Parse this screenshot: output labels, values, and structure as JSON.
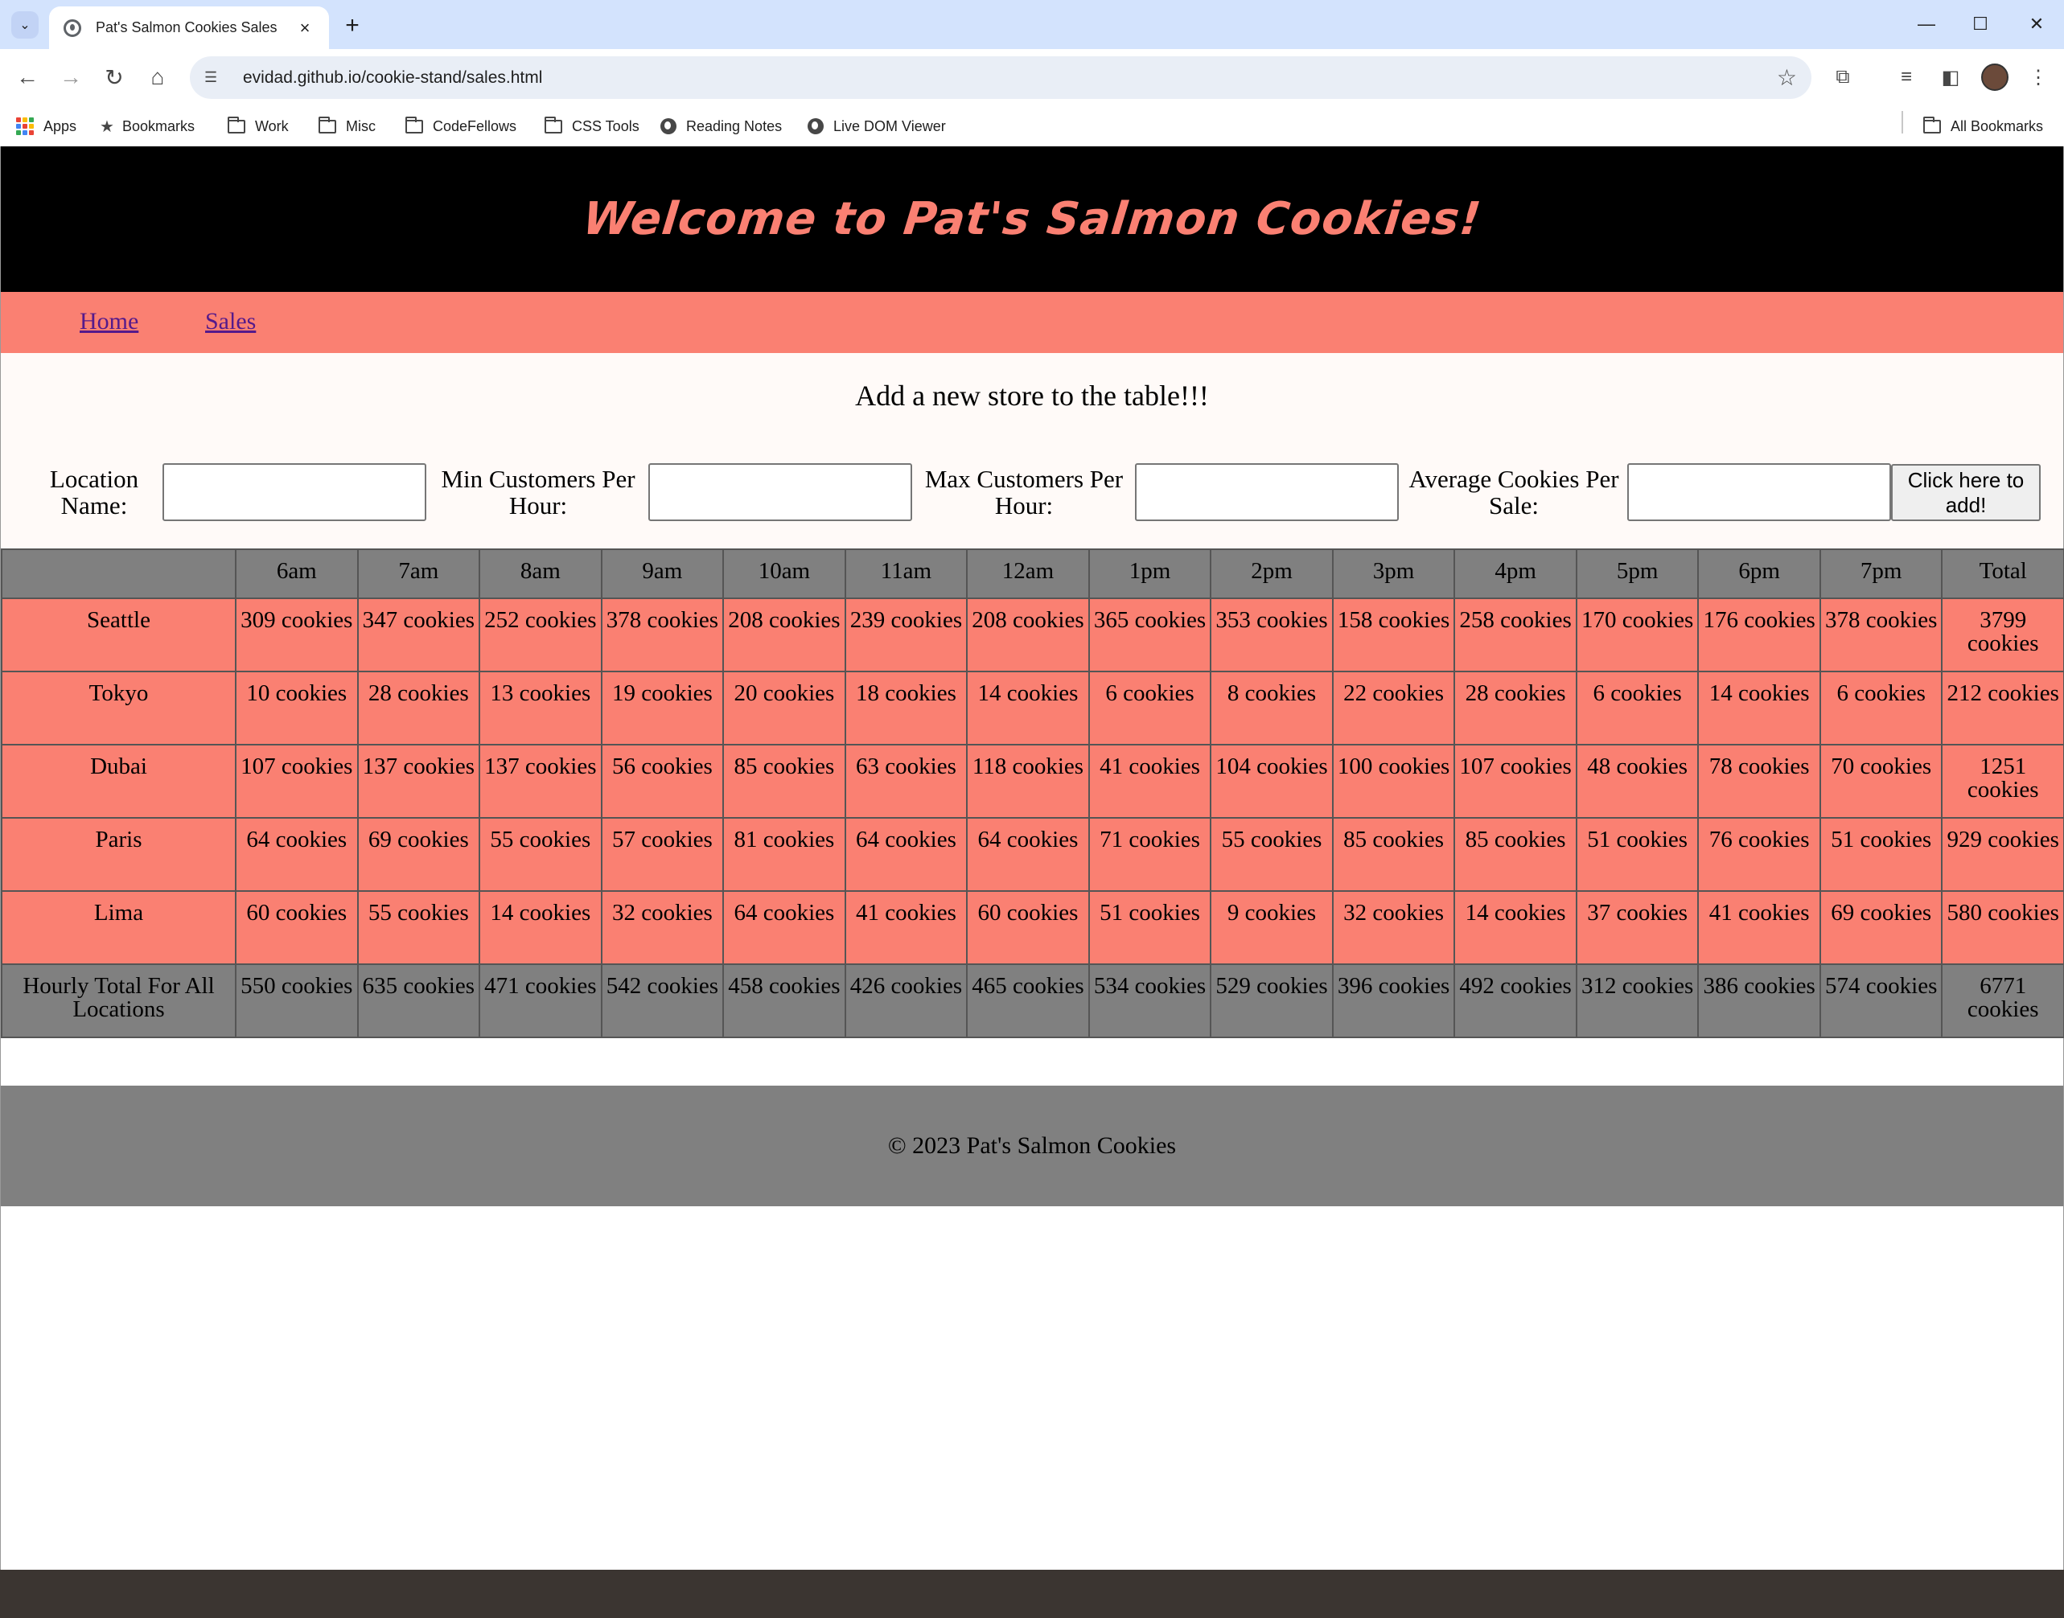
{
  "browser": {
    "tab_title": "Pat's Salmon Cookies Sales",
    "url": "evidad.github.io/cookie-stand/sales.html",
    "bookmarks": [
      "Apps",
      "Bookmarks",
      "Work",
      "Misc",
      "CodeFellows",
      "CSS Tools",
      "Reading Notes",
      "Live DOM Viewer"
    ],
    "all_bookmarks": "All Bookmarks"
  },
  "header": {
    "title": "Welcome to Pat's Salmon Cookies!"
  },
  "nav": {
    "home": "Home",
    "sales": "Sales"
  },
  "form": {
    "heading": "Add a new store to the table!!!",
    "location_label": "Location Name:",
    "min_label": "Min Customers Per Hour:",
    "max_label": "Max Customers Per Hour:",
    "avg_label": "Average Cookies Per Sale:",
    "location_value": "",
    "min_value": "",
    "max_value": "",
    "avg_value": "",
    "submit_label": "Click here to add!"
  },
  "table": {
    "header": [
      "",
      "6am",
      "7am",
      "8am",
      "9am",
      "10am",
      "11am",
      "12am",
      "1pm",
      "2pm",
      "3pm",
      "4pm",
      "5pm",
      "6pm",
      "7pm",
      "Total"
    ],
    "rows": [
      [
        "Seattle",
        "309 cookies",
        "347 cookies",
        "252 cookies",
        "378 cookies",
        "208 cookies",
        "239 cookies",
        "208 cookies",
        "365 cookies",
        "353 cookies",
        "158 cookies",
        "258 cookies",
        "170 cookies",
        "176 cookies",
        "378 cookies",
        "3799 cookies"
      ],
      [
        "Tokyo",
        "10 cookies",
        "28 cookies",
        "13 cookies",
        "19 cookies",
        "20 cookies",
        "18 cookies",
        "14 cookies",
        "6 cookies",
        "8 cookies",
        "22 cookies",
        "28 cookies",
        "6 cookies",
        "14 cookies",
        "6 cookies",
        "212 cookies"
      ],
      [
        "Dubai",
        "107 cookies",
        "137 cookies",
        "137 cookies",
        "56 cookies",
        "85 cookies",
        "63 cookies",
        "118 cookies",
        "41 cookies",
        "104 cookies",
        "100 cookies",
        "107 cookies",
        "48 cookies",
        "78 cookies",
        "70 cookies",
        "1251 cookies"
      ],
      [
        "Paris",
        "64 cookies",
        "69 cookies",
        "55 cookies",
        "57 cookies",
        "81 cookies",
        "64 cookies",
        "64 cookies",
        "71 cookies",
        "55 cookies",
        "85 cookies",
        "85 cookies",
        "51 cookies",
        "76 cookies",
        "51 cookies",
        "929 cookies"
      ],
      [
        "Lima",
        "60 cookies",
        "55 cookies",
        "14 cookies",
        "32 cookies",
        "64 cookies",
        "41 cookies",
        "60 cookies",
        "51 cookies",
        "9 cookies",
        "32 cookies",
        "14 cookies",
        "37 cookies",
        "41 cookies",
        "69 cookies",
        "580 cookies"
      ]
    ],
    "footer": [
      "Hourly Total For All Locations",
      "550 cookies",
      "635 cookies",
      "471 cookies",
      "542 cookies",
      "458 cookies",
      "426 cookies",
      "465 cookies",
      "534 cookies",
      "529 cookies",
      "396 cookies",
      "492 cookies",
      "312 cookies",
      "386 cookies",
      "574 cookies",
      "6771 cookies"
    ]
  },
  "footer": {
    "text": "© 2023 Pat's Salmon Cookies"
  },
  "colors": {
    "salmon": "#fa8072",
    "header_bg": "#000000",
    "gray": "#808080"
  }
}
